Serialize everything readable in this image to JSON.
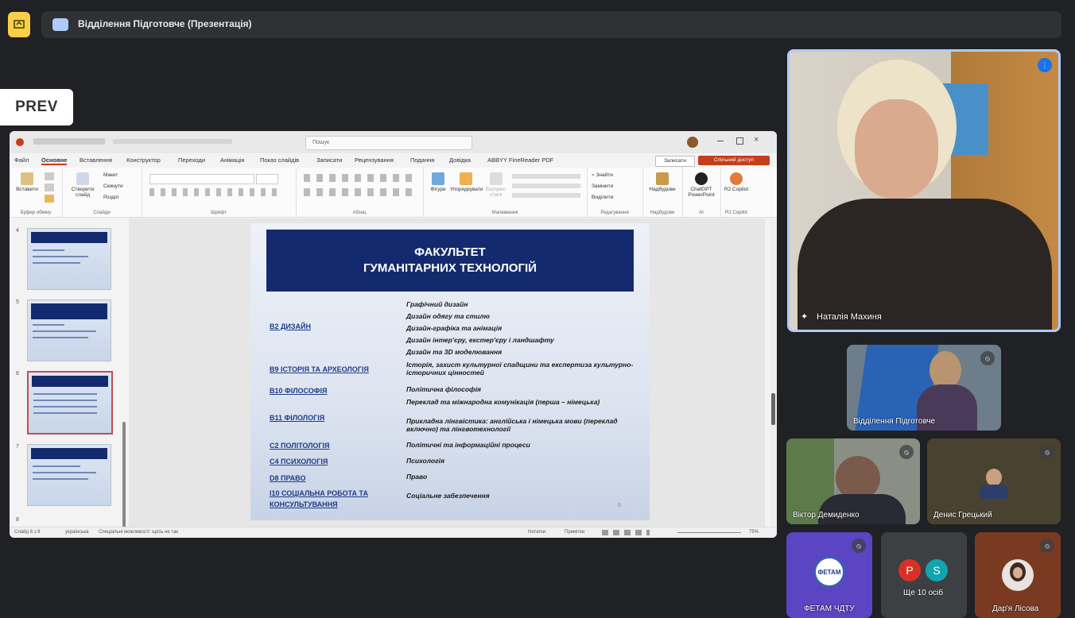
{
  "topbar": {
    "title": "Відділення Підготовче (Презентація)"
  },
  "prev_label": "PREV",
  "ppt": {
    "search_placeholder": "Пошук",
    "menu": [
      "Файл",
      "Основне",
      "Вставлення",
      "Конструктор",
      "Переходи",
      "Анімація",
      "Показ слайдів",
      "Записати",
      "Рецензування",
      "Подання",
      "Довідка",
      "ABBYY FineReader PDF"
    ],
    "record_label": "Записати",
    "share_label": "Спільний доступ",
    "ribbon": {
      "paste": "Вставити",
      "clipboard": "Буфер обміну",
      "new_slide": "Створити слайд",
      "layout": "Макет",
      "reset": "Скинути",
      "section": "Розділ",
      "slides": "Слайди",
      "font": "Шрифт",
      "paragraph": "Абзац",
      "shapes": "Фігури",
      "arrange": "Упорядкувати",
      "quick_styles": "Експрес-стилі",
      "drawing": "Малювання",
      "find": "Знайти",
      "replace": "Замінити",
      "select": "Виділити",
      "editing": "Редагування",
      "addins": "Надбудови",
      "addins_group": "Надбудови",
      "chatgpt": "ChatGPT PowerPoint",
      "ai": "AI",
      "copilot": "R2 Copilot",
      "copilot_group": "R2 Copilot"
    },
    "thumbnails": [
      {
        "num": "4"
      },
      {
        "num": "5"
      },
      {
        "num": "6"
      },
      {
        "num": "7"
      },
      {
        "num": "8"
      }
    ],
    "slide": {
      "title_line1": "ФАКУЛЬТЕТ",
      "title_line2": "ГУМАНІТАРНИХ ТЕХНОЛОГІЙ",
      "specialties": [
        "B2 ДИЗАЙН",
        "B9 ІСТОРІЯ ТА АРХЕОЛОГІЯ",
        "B10 ФІЛОСОФІЯ",
        "B11 ФІЛОЛОГІЯ",
        "C2 ПОЛІТОЛОГІЯ",
        "C4 ПСИХОЛОГІЯ",
        "D8 ПРАВО",
        "I10 СОЦІАЛЬНА РОБОТА ТА КОНСУЛЬТУВАННЯ"
      ],
      "programs": [
        "Графічний дизайн",
        "Дизайн одягу та стилю",
        "Дизайн-графіка та анімація",
        "Дизайн інтер'єру, екстер'єру і ландшафту",
        "Дизайн та 3D моделювання",
        "Історія, захист культурної спадщини та експертиза культурно-історичних цінностей",
        "Політична філософія",
        "Переклад та міжнародна комунікація (перша – німецька)",
        "Прикладна лінгвістика: англійська і німецька мови (переклад включно) та лінгвотехнології",
        "Політичні та інформаційні процеси",
        "Психологія",
        "Право",
        "Соціальне забезпечення"
      ],
      "page_num": "6"
    },
    "status": {
      "slide": "Слайд 6 з 8",
      "language": "українська",
      "accessibility": "Спеціальні можливості: щось не так",
      "notes": "Нотатки",
      "comments": "Примітки",
      "zoom": "75%"
    }
  },
  "participants": {
    "main": {
      "name": "Наталія Махиня"
    },
    "t1": {
      "name": "Відділення Підготовче"
    },
    "t2": {
      "name": "Віктор Демиденко"
    },
    "t3": {
      "name": "Денис Грецький"
    },
    "t4": {
      "name": "ФЕТАМ ЧДТУ",
      "logo_text": "ФЕТАМ"
    },
    "t5": {
      "name": "Ще 10 осіб",
      "avatar1": "P",
      "avatar2": "S"
    },
    "t6": {
      "name": "Дар'я Лісова"
    }
  },
  "colors": {
    "background": "#202124",
    "slide_header": "#132b6e",
    "specialty_text": "#1f3c88",
    "share_button": "#c43e1c",
    "active_speaker_border": "#aecbfa"
  }
}
